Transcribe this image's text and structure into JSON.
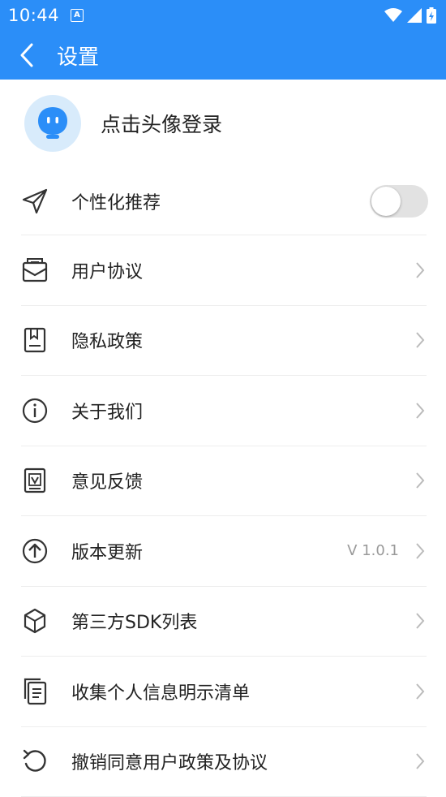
{
  "status_bar": {
    "time": "10:44",
    "notification": "A"
  },
  "header": {
    "title": "设置"
  },
  "profile": {
    "login_label": "点击头像登录"
  },
  "settings": {
    "personalized": {
      "label": "个性化推荐",
      "enabled": false
    },
    "user_agreement": {
      "label": "用户协议"
    },
    "privacy_policy": {
      "label": "隐私政策"
    },
    "about_us": {
      "label": "关于我们"
    },
    "feedback": {
      "label": "意见反馈"
    },
    "version_update": {
      "label": "版本更新",
      "value": "V 1.0.1"
    },
    "third_party_sdk": {
      "label": "第三方SDK列表"
    },
    "personal_info_list": {
      "label": "收集个人信息明示清单"
    },
    "revoke_consent": {
      "label": "撤销同意用户政策及协议"
    }
  },
  "colors": {
    "primary": "#2b8ef8",
    "avatar_bg": "#d8ebfb",
    "avatar_fg": "#2b8ef8",
    "toggle_off": "#e2e2e2"
  }
}
